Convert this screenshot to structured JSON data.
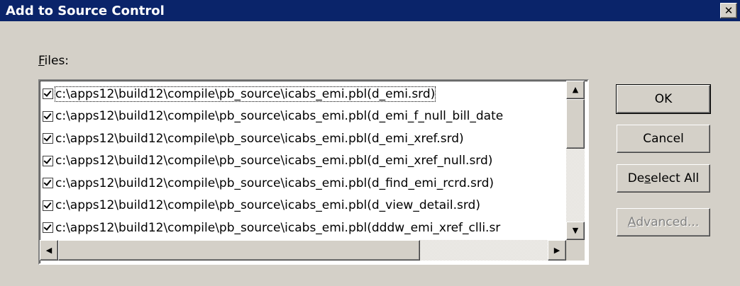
{
  "window": {
    "title": "Add to Source Control",
    "close_glyph": "✕"
  },
  "files_label": {
    "mnemonic": "F",
    "rest": "iles:"
  },
  "files": [
    {
      "checked": true,
      "path": "c:\\apps12\\build12\\compile\\pb_source\\icabs_emi.pbl(d_emi.srd)"
    },
    {
      "checked": true,
      "path": "c:\\apps12\\build12\\compile\\pb_source\\icabs_emi.pbl(d_emi_f_null_bill_date"
    },
    {
      "checked": true,
      "path": "c:\\apps12\\build12\\compile\\pb_source\\icabs_emi.pbl(d_emi_xref.srd)"
    },
    {
      "checked": true,
      "path": "c:\\apps12\\build12\\compile\\pb_source\\icabs_emi.pbl(d_emi_xref_null.srd)"
    },
    {
      "checked": true,
      "path": "c:\\apps12\\build12\\compile\\pb_source\\icabs_emi.pbl(d_find_emi_rcrd.srd)"
    },
    {
      "checked": true,
      "path": "c:\\apps12\\build12\\compile\\pb_source\\icabs_emi.pbl(d_view_detail.srd)"
    },
    {
      "checked": true,
      "path": "c:\\apps12\\build12\\compile\\pb_source\\icabs_emi.pbl(dddw_emi_xref_clli.sr"
    }
  ],
  "scrollbar": {
    "up_arrow": "▲",
    "down_arrow": "▼",
    "left_arrow": "◀",
    "right_arrow": "▶",
    "vertical_position": 0.0,
    "horizontal_position": 0.0
  },
  "buttons": {
    "ok": "OK",
    "cancel": "Cancel",
    "deselect_all": {
      "before": "De",
      "mnemonic": "s",
      "after": "elect All"
    },
    "advanced": {
      "before": "",
      "mnemonic": "A",
      "after": "dvanced..."
    }
  },
  "colors": {
    "title_bar": "#0a246a",
    "dialog_face": "#d4d0c8",
    "list_background": "#ffffff",
    "disabled_text": "#808080"
  }
}
